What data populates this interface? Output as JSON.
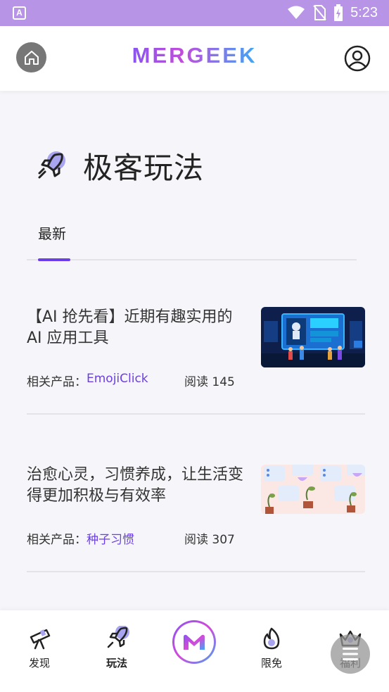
{
  "status_bar": {
    "app_icon_letter": "A",
    "time": "5:23",
    "icons": [
      "wifi-icon",
      "no-sim-icon",
      "battery-charging-icon"
    ]
  },
  "header": {
    "logo_text": "MERGEEK",
    "home_icon": "home-icon",
    "profile_icon": "user-icon"
  },
  "page": {
    "title": "极客玩法",
    "title_icon": "rocket-icon"
  },
  "tabs": [
    {
      "label": "最新",
      "active": true
    }
  ],
  "articles": [
    {
      "title": "【AI 抢先看】近期有趣实用的 AI 应用工具",
      "product_label": "相关产品：",
      "product": "EmojiClick",
      "reads": "阅读 145",
      "thumb": "ai-robot-scene"
    },
    {
      "title": "治愈心灵，习惯养成，让生活变得更加积极与有效率",
      "product_label": "相关产品：",
      "product": "种子习惯",
      "reads": "阅读 307",
      "thumb": "habit-cards-pattern"
    }
  ],
  "bottom_nav": {
    "items": [
      {
        "label": "发现",
        "icon": "telescope-icon",
        "active": false
      },
      {
        "label": "玩法",
        "icon": "rocket-icon",
        "active": true
      },
      {
        "label": "",
        "icon": "mergeek-m-icon",
        "active": false
      },
      {
        "label": "限免",
        "icon": "flame-icon",
        "active": false
      },
      {
        "label": "福利",
        "icon": "crown-icon",
        "active": false
      }
    ]
  },
  "colors": {
    "accent": "#6b3ee8",
    "status_bar": "#b794e6",
    "background": "#f6f6fa"
  }
}
